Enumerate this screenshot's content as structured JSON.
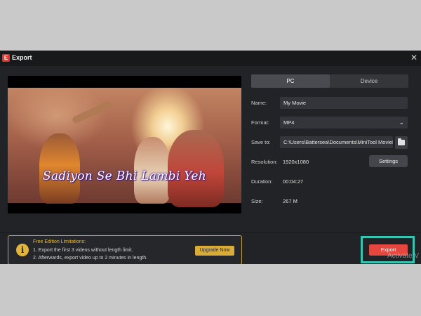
{
  "window": {
    "title": "Export",
    "app_logo_text": "E",
    "close_symbol": "✕"
  },
  "preview": {
    "subtitle": "Sadiyon Se Bhi Lambi Yeh"
  },
  "target_tabs": [
    {
      "label": "PC",
      "active": true
    },
    {
      "label": "Device",
      "active": false
    }
  ],
  "form": {
    "name_label": "Name:",
    "name_value": "My Movie",
    "format_label": "Format:",
    "format_value": "MP4",
    "save_label": "Save to:",
    "save_value": "C:\\Users\\Battersea\\Documents\\MiniTool MovieMa",
    "resolution_label": "Resolution:",
    "resolution_value": "1920x1080",
    "settings_label": "Settings",
    "duration_label": "Duration:",
    "duration_value": "00:04:27",
    "size_label": "Size:",
    "size_value": "267 M"
  },
  "limitations": {
    "title": "Free Edition Limitations:",
    "line1": "1. Export the first 3 videos without length limit.",
    "line2": "2. Afterwards, export video up to 2 minutes in length.",
    "upgrade_label": "Upgrade Now",
    "info_symbol": "i"
  },
  "export_label": "Export",
  "watermark": "Activate V",
  "colors": {
    "accent_red": "#e5463d",
    "upgrade_gold": "#d9ac3a",
    "highlight_teal": "#36c5b3"
  }
}
